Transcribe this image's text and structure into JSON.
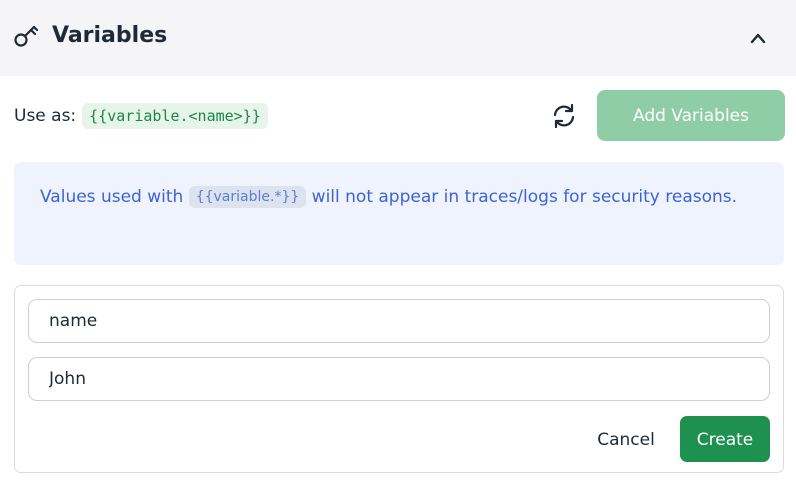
{
  "header": {
    "icon": "key-icon",
    "title": "Variables",
    "collapse_icon": "chevron-up-icon"
  },
  "toolbar": {
    "use_as_label": "Use as:",
    "use_as_code": "{{variable.<name>}}",
    "refresh_icon": "refresh-icon",
    "add_button_label": "Add Variables",
    "add_button_color": "#8fcda6"
  },
  "notice": {
    "text_before": "Values used with",
    "code": "{{variable.*}}",
    "text_after": "will not appear in traces/logs for security reasons.",
    "text_color": "#3f63d3",
    "background": "#eef3fe"
  },
  "form": {
    "name_value": "name",
    "value_value": "John",
    "cancel_label": "Cancel",
    "create_label": "Create",
    "create_color": "#1e9150"
  }
}
